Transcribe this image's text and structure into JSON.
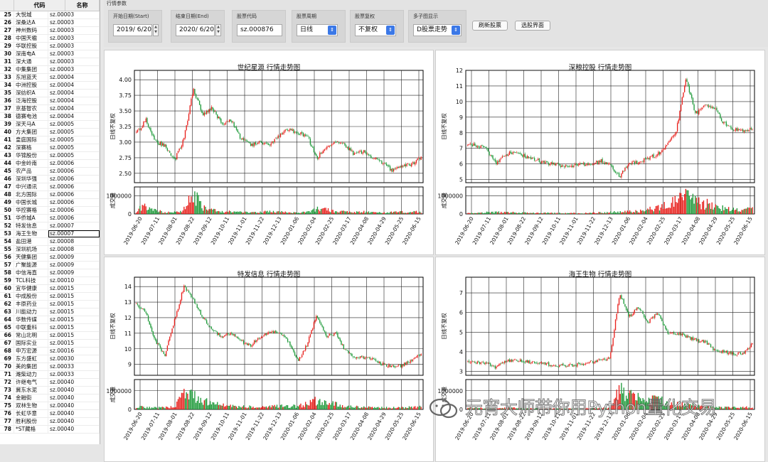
{
  "stock_table": {
    "headers": {
      "code": "代码",
      "name": "名称"
    },
    "selected_index": 28,
    "rows": [
      {
        "idx": "25",
        "name": "大悦城",
        "code": "sz.00003"
      },
      {
        "idx": "26",
        "name": "深桑达A",
        "code": "sz.00003"
      },
      {
        "idx": "27",
        "name": "神州数码",
        "code": "sz.00003"
      },
      {
        "idx": "28",
        "name": "中国天楹",
        "code": "sz.00003"
      },
      {
        "idx": "29",
        "name": "华联控股",
        "code": "sz.00003"
      },
      {
        "idx": "30",
        "name": "深南电A",
        "code": "sz.00003"
      },
      {
        "idx": "31",
        "name": "深大通",
        "code": "sz.00003"
      },
      {
        "idx": "32",
        "name": "中集集团",
        "code": "sz.00003"
      },
      {
        "idx": "33",
        "name": "东旭蓝天",
        "code": "sz.00004"
      },
      {
        "idx": "34",
        "name": "中洲控股",
        "code": "sz.00004"
      },
      {
        "idx": "35",
        "name": "深纺织A",
        "code": "sz.00004"
      },
      {
        "idx": "36",
        "name": "泛海控股",
        "code": "sz.00004"
      },
      {
        "idx": "37",
        "name": "京基智农",
        "code": "sz.00004"
      },
      {
        "idx": "38",
        "name": "德赛电池",
        "code": "sz.00004"
      },
      {
        "idx": "39",
        "name": "深天马A",
        "code": "sz.00005"
      },
      {
        "idx": "40",
        "name": "方大集团",
        "code": "sz.00005"
      },
      {
        "idx": "41",
        "name": "皇庭国际",
        "code": "sz.00005"
      },
      {
        "idx": "42",
        "name": "深赛格",
        "code": "sz.00005"
      },
      {
        "idx": "43",
        "name": "华锦股份",
        "code": "sz.00005"
      },
      {
        "idx": "44",
        "name": "中金岭南",
        "code": "sz.00006"
      },
      {
        "idx": "45",
        "name": "农产品",
        "code": "sz.00006"
      },
      {
        "idx": "46",
        "name": "深圳华强",
        "code": "sz.00006"
      },
      {
        "idx": "47",
        "name": "中兴通讯",
        "code": "sz.00006"
      },
      {
        "idx": "48",
        "name": "北方国际",
        "code": "sz.00006"
      },
      {
        "idx": "49",
        "name": "中国长城",
        "code": "sz.00006"
      },
      {
        "idx": "50",
        "name": "华控赛格",
        "code": "sz.00006"
      },
      {
        "idx": "51",
        "name": "华侨城A",
        "code": "sz.00006"
      },
      {
        "idx": "52",
        "name": "特发信息",
        "code": "sz.00007"
      },
      {
        "idx": "53",
        "name": "海王生物",
        "code": "sz.00007"
      },
      {
        "idx": "54",
        "name": "盐田港",
        "code": "sz.00008"
      },
      {
        "idx": "55",
        "name": "深圳机场",
        "code": "sz.00008"
      },
      {
        "idx": "56",
        "name": "天健集团",
        "code": "sz.00009"
      },
      {
        "idx": "57",
        "name": "广聚能源",
        "code": "sz.00009"
      },
      {
        "idx": "58",
        "name": "中信海直",
        "code": "sz.00009"
      },
      {
        "idx": "59",
        "name": "TCL科技",
        "code": "sz.00010"
      },
      {
        "idx": "60",
        "name": "宜华健康",
        "code": "sz.00015"
      },
      {
        "idx": "61",
        "name": "中成股份",
        "code": "sz.00015"
      },
      {
        "idx": "62",
        "name": "丰原药业",
        "code": "sz.00015"
      },
      {
        "idx": "63",
        "name": "川能动力",
        "code": "sz.00015"
      },
      {
        "idx": "64",
        "name": "华数传媒",
        "code": "sz.00015"
      },
      {
        "idx": "65",
        "name": "中联重科",
        "code": "sz.00015"
      },
      {
        "idx": "66",
        "name": "常山北明",
        "code": "sz.00015"
      },
      {
        "idx": "67",
        "name": "国际实业",
        "code": "sz.00015"
      },
      {
        "idx": "68",
        "name": "申万宏源",
        "code": "sz.00016"
      },
      {
        "idx": "69",
        "name": "东方盛虹",
        "code": "sz.00030"
      },
      {
        "idx": "70",
        "name": "美的集团",
        "code": "sz.00033"
      },
      {
        "idx": "71",
        "name": "潍柴动力",
        "code": "sz.00033"
      },
      {
        "idx": "72",
        "name": "许继电气",
        "code": "sz.00040"
      },
      {
        "idx": "73",
        "name": "冀东水泥",
        "code": "sz.00040"
      },
      {
        "idx": "74",
        "name": "金融街",
        "code": "sz.00040"
      },
      {
        "idx": "75",
        "name": "双林生物",
        "code": "sz.00040"
      },
      {
        "idx": "76",
        "name": "长虹华意",
        "code": "sz.00040"
      },
      {
        "idx": "77",
        "name": "胜利股份",
        "code": "sz.00040"
      },
      {
        "idx": "78",
        "name": "*ST藏格",
        "code": "sz.00040"
      }
    ]
  },
  "params": {
    "title": "行情参数",
    "start_label": "开始日期(Start)",
    "start_value": "2019/  6/20",
    "end_label": "结束日期(End)",
    "end_value": "2020/  6/20",
    "code_label": "股票代码",
    "code_value": "sz.000876",
    "period_label": "股票周期",
    "period_value": "日线",
    "adjust_label": "股票复权",
    "adjust_value": "不复权",
    "multi_label": "多子图显示",
    "multi_value": "D股票走势",
    "refresh_button": "刷新股票",
    "select_button": "选股界面"
  },
  "watermark": "元宵大师带你用Python量化交易",
  "colors": {
    "up": "#e8201c",
    "down": "#1f9a3a",
    "grid": "#222222"
  },
  "chart_data": [
    {
      "type": "candlestick",
      "title": "世纪星源  行情走势图",
      "ylabel": "日线不复权",
      "volume_label": "成交量",
      "ylim": [
        2.35,
        4.15
      ],
      "yticks": [
        2.5,
        2.75,
        3.0,
        3.25,
        3.5,
        3.75,
        4.0
      ],
      "vol_ylim": [
        0,
        1500000
      ],
      "vol_ticks": [
        "0",
        "1000000"
      ],
      "x_dates": [
        "2019-06-20",
        "2019-07-11",
        "2019-08-01",
        "2019-08-22",
        "2019-09-12",
        "2019-10-11",
        "2019-11-01",
        "2019-11-22",
        "2019-12-13",
        "2020-01-06",
        "2020-02-04",
        "2020-02-25",
        "2020-03-17",
        "2020-04-08",
        "2020-04-29",
        "2020-05-25",
        "2020-06-15"
      ],
      "close_path": [
        3.15,
        3.35,
        3.0,
        2.95,
        2.7,
        3.05,
        3.85,
        3.45,
        3.55,
        3.3,
        3.35,
        3.05,
        2.95,
        3.0,
        2.95,
        3.1,
        3.2,
        3.15,
        3.1,
        2.75,
        2.9,
        3.0,
        2.95,
        2.8,
        2.85,
        2.75,
        2.65,
        2.55,
        2.6,
        2.65,
        2.75
      ],
      "volume_path": [
        0.15,
        0.55,
        0.2,
        0.1,
        0.12,
        0.25,
        1.1,
        0.35,
        0.2,
        0.15,
        0.12,
        0.1,
        0.08,
        0.1,
        0.15,
        0.12,
        0.1,
        0.08,
        0.1,
        0.3,
        0.25,
        0.18,
        0.12,
        0.1,
        0.12,
        0.1,
        0.08,
        0.1,
        0.12,
        0.1,
        0.15
      ]
    },
    {
      "type": "candlestick",
      "title": "深粮控股  行情走势图",
      "ylabel": "日线不复权",
      "volume_label": "成交量",
      "ylim": [
        4.8,
        12
      ],
      "yticks": [
        5,
        6,
        7,
        8,
        9,
        10,
        11,
        12
      ],
      "vol_ylim": [
        0,
        1500000
      ],
      "vol_ticks": [
        "0",
        "1000000"
      ],
      "x_dates": [
        "2019-06-20",
        "2019-07-11",
        "2019-08-01",
        "2019-08-22",
        "2019-09-12",
        "2019-10-11",
        "2019-11-01",
        "2019-11-22",
        "2019-12-13",
        "2020-01-06",
        "2020-02-04",
        "2020-02-25",
        "2020-03-17",
        "2020-04-08",
        "2020-04-29",
        "2020-05-25",
        "2020-06-15"
      ],
      "close_path": [
        7.2,
        7.2,
        6.9,
        6.0,
        6.6,
        6.8,
        6.5,
        6.3,
        6.1,
        6.0,
        5.9,
        5.9,
        5.95,
        6.0,
        6.2,
        5.9,
        5.2,
        6.0,
        6.1,
        6.4,
        6.6,
        7.2,
        8.2,
        11.5,
        9.2,
        9.8,
        9.6,
        8.6,
        8.2,
        8.1,
        8.3
      ],
      "volume_path": [
        0.05,
        0.05,
        0.1,
        0.1,
        0.1,
        0.08,
        0.08,
        0.06,
        0.06,
        0.05,
        0.05,
        0.05,
        0.05,
        0.05,
        0.08,
        0.1,
        0.12,
        0.15,
        0.15,
        0.25,
        0.35,
        0.6,
        0.7,
        1.0,
        0.7,
        0.6,
        0.5,
        0.3,
        0.25,
        0.2,
        0.3
      ]
    },
    {
      "type": "candlestick",
      "title": "特发信息  行情走势图",
      "ylabel": "日线不复权",
      "volume_label": "成交量",
      "ylim": [
        8.3,
        14.6
      ],
      "yticks": [
        9,
        10,
        11,
        12,
        13,
        14
      ],
      "vol_ylim": [
        0,
        1600000
      ],
      "vol_ticks": [
        "0",
        "1000000"
      ],
      "x_dates": [
        "2019-06-20",
        "2019-07-11",
        "2019-08-01",
        "2019-08-22",
        "2019-09-12",
        "2019-10-11",
        "2019-11-01",
        "2019-11-22",
        "2019-12-13",
        "2020-01-06",
        "2020-02-04",
        "2020-02-25",
        "2020-03-17",
        "2020-04-08",
        "2020-04-29",
        "2020-05-25",
        "2020-06-15"
      ],
      "close_path": [
        12.9,
        12.3,
        10.5,
        9.6,
        11.8,
        14.0,
        13.2,
        12.0,
        11.2,
        10.8,
        11.0,
        10.5,
        10.2,
        10.8,
        11.0,
        11.1,
        10.5,
        9.2,
        10.3,
        12.2,
        10.8,
        11.0,
        9.9,
        9.5,
        9.4,
        9.3,
        9.0,
        8.9,
        8.9,
        9.3,
        9.7
      ],
      "volume_path": [
        0.15,
        0.12,
        0.1,
        0.1,
        0.15,
        0.8,
        0.7,
        0.5,
        0.3,
        0.25,
        0.2,
        0.15,
        0.15,
        0.12,
        0.15,
        0.2,
        0.15,
        0.2,
        0.3,
        0.5,
        0.35,
        0.3,
        0.2,
        0.15,
        0.12,
        0.1,
        0.1,
        0.1,
        0.1,
        0.12,
        0.15
      ]
    },
    {
      "type": "candlestick",
      "title": "海王生物  行情走势图",
      "ylabel": "日线不复权",
      "volume_label": "成交量",
      "ylim": [
        2.8,
        7.8
      ],
      "yticks": [
        3,
        4,
        5,
        6,
        7
      ],
      "vol_ylim": [
        0,
        1600000
      ],
      "vol_ticks": [
        "0",
        "1000000"
      ],
      "x_dates": [
        "2019-06-20",
        "2019-07-11",
        "2019-08-01",
        "2019-08-22",
        "2019-09-12",
        "2019-10-11",
        "2019-11-01",
        "2019-11-22",
        "2019-12-13",
        "2020-01-06",
        "2020-02-04",
        "2020-02-25",
        "2020-03-17",
        "2020-04-08",
        "2020-04-29",
        "2020-05-25",
        "2020-06-15"
      ],
      "close_path": [
        3.5,
        3.45,
        3.4,
        3.2,
        3.5,
        3.6,
        3.5,
        3.45,
        3.4,
        3.3,
        3.3,
        3.3,
        3.35,
        3.5,
        3.6,
        3.7,
        7.0,
        5.8,
        6.3,
        5.5,
        6.0,
        5.0,
        4.9,
        4.8,
        4.6,
        4.5,
        4.1,
        4.0,
        3.9,
        3.9,
        4.4
      ],
      "volume_path": [
        0.08,
        0.08,
        0.06,
        0.06,
        0.08,
        0.08,
        0.06,
        0.05,
        0.05,
        0.05,
        0.05,
        0.05,
        0.05,
        0.06,
        0.08,
        0.1,
        1.0,
        0.8,
        0.7,
        0.5,
        0.55,
        0.4,
        0.3,
        0.25,
        0.2,
        0.15,
        0.12,
        0.1,
        0.1,
        0.1,
        0.15
      ]
    }
  ]
}
